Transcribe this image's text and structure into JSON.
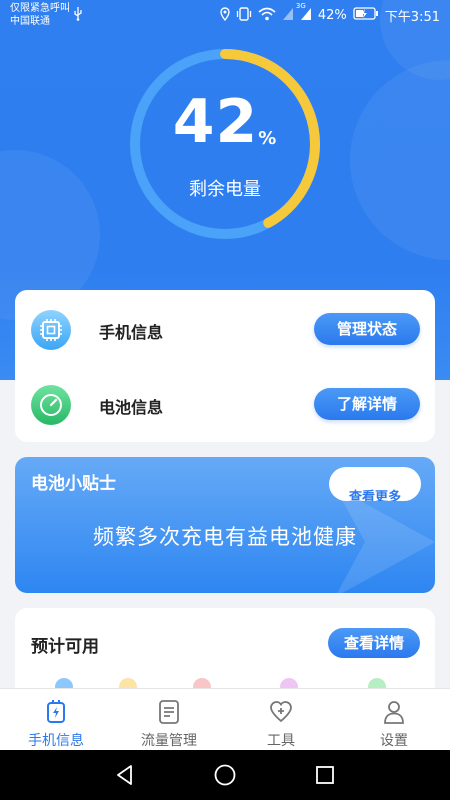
{
  "status_bar": {
    "carrier_line1": "仅限紧急呼叫",
    "carrier_line2": "中国联通",
    "network_label": "3G",
    "battery_text": "42%",
    "time": "下午3:51"
  },
  "battery": {
    "percent": "42",
    "unit": "%",
    "label": "剩余电量",
    "level_fraction": 0.42
  },
  "info_card": {
    "rows": [
      {
        "label": "手机信息",
        "button": "管理状态",
        "icon": "chip-icon"
      },
      {
        "label": "电池信息",
        "button": "了解详情",
        "icon": "gauge-icon"
      }
    ]
  },
  "tips": {
    "title": "电池小贴士",
    "more_button": "查看更多",
    "body": "频繁多次充电有益电池健康"
  },
  "estimate": {
    "title": "预计可用",
    "button": "查看详情"
  },
  "tabs": [
    {
      "label": "手机信息",
      "icon": "battery-plug-icon",
      "active": true
    },
    {
      "label": "流量管理",
      "icon": "document-icon",
      "active": false
    },
    {
      "label": "工具",
      "icon": "heart-plus-icon",
      "active": false
    },
    {
      "label": "设置",
      "icon": "person-icon",
      "active": false
    }
  ],
  "colors": {
    "primary": "#2b79ee",
    "hero": "#2f7ff0",
    "ring_track": "#4aa3f8",
    "ring_progress": "#f6c83c"
  }
}
